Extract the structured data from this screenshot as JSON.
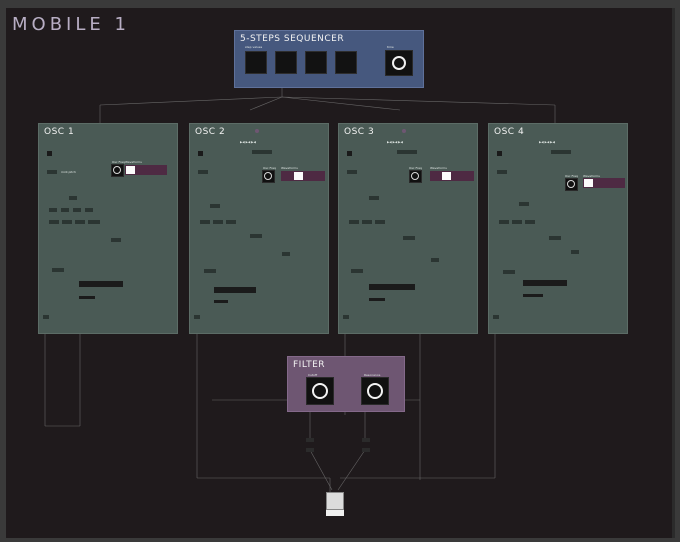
{
  "window": {
    "title": "MOBILE 1"
  },
  "sequencer": {
    "title": "5-STEPS  SEQUENCER",
    "steps_label": "step values",
    "knob_label": "time"
  },
  "oscillators": [
    {
      "title": "OSC 1",
      "freq_label": "Osc Freq",
      "wave_label": "Waveforms"
    },
    {
      "title": "OSC 2",
      "freq_label": "Osc Freq",
      "wave_label": "Waveforms"
    },
    {
      "title": "OSC 3",
      "freq_label": "Osc Freq",
      "wave_label": "Waveforms"
    },
    {
      "title": "OSC 4",
      "freq_label": "Osc Freq",
      "wave_label": "Waveforms"
    }
  ],
  "filter": {
    "title": "FILTER",
    "cutoff_label": "Cutoff",
    "resonance_label": "Resonance"
  },
  "colors": {
    "sequencer": "#46587e",
    "oscillator": "#4a5a55",
    "filter": "#6e5672",
    "background": "#1f1a1c"
  }
}
